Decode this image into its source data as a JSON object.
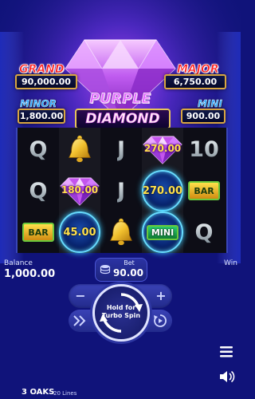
{
  "jackpots": {
    "grand": {
      "label": "GRAND",
      "value": "90,000.00"
    },
    "major": {
      "label": "MAJOR",
      "value": "6,750.00"
    },
    "minor": {
      "label": "MINOR",
      "value": "1,800.00"
    },
    "mini": {
      "label": "MINI",
      "value": "900.00"
    }
  },
  "logo": {
    "line1": "PURPLE",
    "line2": "DIAMOND"
  },
  "reels": [
    [
      {
        "symbol": "letter",
        "text": "Q"
      },
      {
        "symbol": "letter",
        "text": "Q"
      },
      {
        "symbol": "bar",
        "text": "BAR"
      }
    ],
    [
      {
        "symbol": "bell"
      },
      {
        "symbol": "diamond",
        "text": "180.00"
      },
      {
        "symbol": "orb",
        "text": "45.00"
      }
    ],
    [
      {
        "symbol": "letter",
        "text": "J"
      },
      {
        "symbol": "letter",
        "text": "J"
      },
      {
        "symbol": "bell"
      }
    ],
    [
      {
        "symbol": "diamond",
        "text": "270.00"
      },
      {
        "symbol": "orb",
        "text": "270.00"
      },
      {
        "symbol": "orb",
        "text": "MINI"
      }
    ],
    [
      {
        "symbol": "letter",
        "text": "10"
      },
      {
        "symbol": "bar",
        "text": "BAR"
      },
      {
        "symbol": "letter",
        "text": "Q"
      }
    ]
  ],
  "balance": {
    "label": "Balance",
    "value": "1,000.00"
  },
  "bet": {
    "label": "Bet",
    "value": "90.00"
  },
  "win": {
    "label": "Win"
  },
  "spin": {
    "line1": "Hold for",
    "line2": "Turbo Spin"
  },
  "footer": {
    "brand": "3 OAKS",
    "lines": "20 Lines"
  },
  "icons": {
    "menu": "hamburger-menu-icon",
    "sound": "speaker-icon",
    "minus": "minus-icon",
    "plus": "plus-icon",
    "turbo": "fast-forward-icon",
    "autoplay": "autoplay-icon",
    "spin": "spin-arrows-icon",
    "stack": "coin-stack-icon"
  },
  "colors": {
    "background": "#10137a",
    "accent_gold": "#ffe04a",
    "jackpot_red": "#ff2222",
    "jackpot_blue": "#2aa5ff",
    "orb_glow": "#3ccbff"
  }
}
